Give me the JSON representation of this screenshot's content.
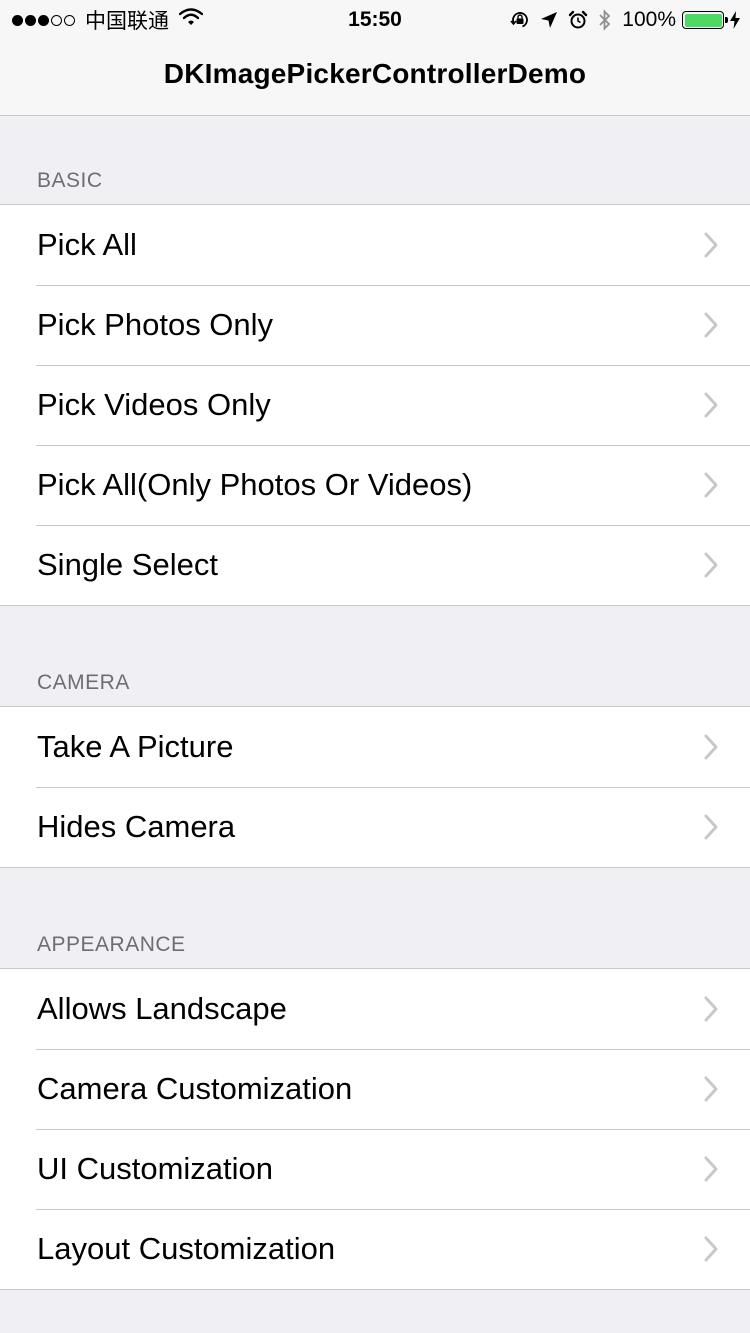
{
  "status_bar": {
    "carrier": "中国联通",
    "time": "15:50",
    "battery": "100%",
    "battery_level": 1.0,
    "battery_color": "#4cd964"
  },
  "nav": {
    "title": "DKImagePickerControllerDemo"
  },
  "sections": [
    {
      "header": "BASIC",
      "items": [
        "Pick All",
        "Pick Photos Only",
        "Pick Videos Only",
        "Pick All(Only Photos Or Videos)",
        "Single Select"
      ]
    },
    {
      "header": "CAMERA",
      "items": [
        "Take A Picture",
        "Hides Camera"
      ]
    },
    {
      "header": "APPEARANCE",
      "items": [
        "Allows Landscape",
        "Camera Customization",
        "UI Customization",
        "Layout Customization"
      ]
    }
  ],
  "icons": {
    "signal": "signal-dots-icon",
    "wifi": "wifi-icon",
    "rotation_lock": "rotation-lock-icon",
    "location": "location-arrow-icon",
    "alarm": "alarm-icon",
    "bluetooth": "bluetooth-icon",
    "battery": "battery-icon",
    "charging": "charging-bolt-icon",
    "disclosure": "chevron-right-icon"
  },
  "colors": {
    "background": "#efeff4",
    "separator": "#c8c7cc",
    "header_text": "#6d6d72",
    "chevron": "#c7c7cc"
  }
}
